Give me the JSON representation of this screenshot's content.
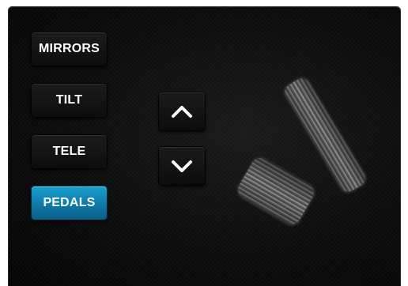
{
  "modes": {
    "mirrors_label": "MIRRORS",
    "tilt_label": "TILT",
    "tele_label": "TELE",
    "pedals_label": "PEDALS",
    "active": "PEDALS"
  },
  "adjust": {
    "up_icon": "chevron-up-icon",
    "down_icon": "chevron-down-icon"
  },
  "illustration": {
    "icon": "pedals-icon"
  },
  "colors": {
    "active_button": "#0e79a8",
    "background": "#0c0c0c",
    "text": "#ffffff"
  }
}
